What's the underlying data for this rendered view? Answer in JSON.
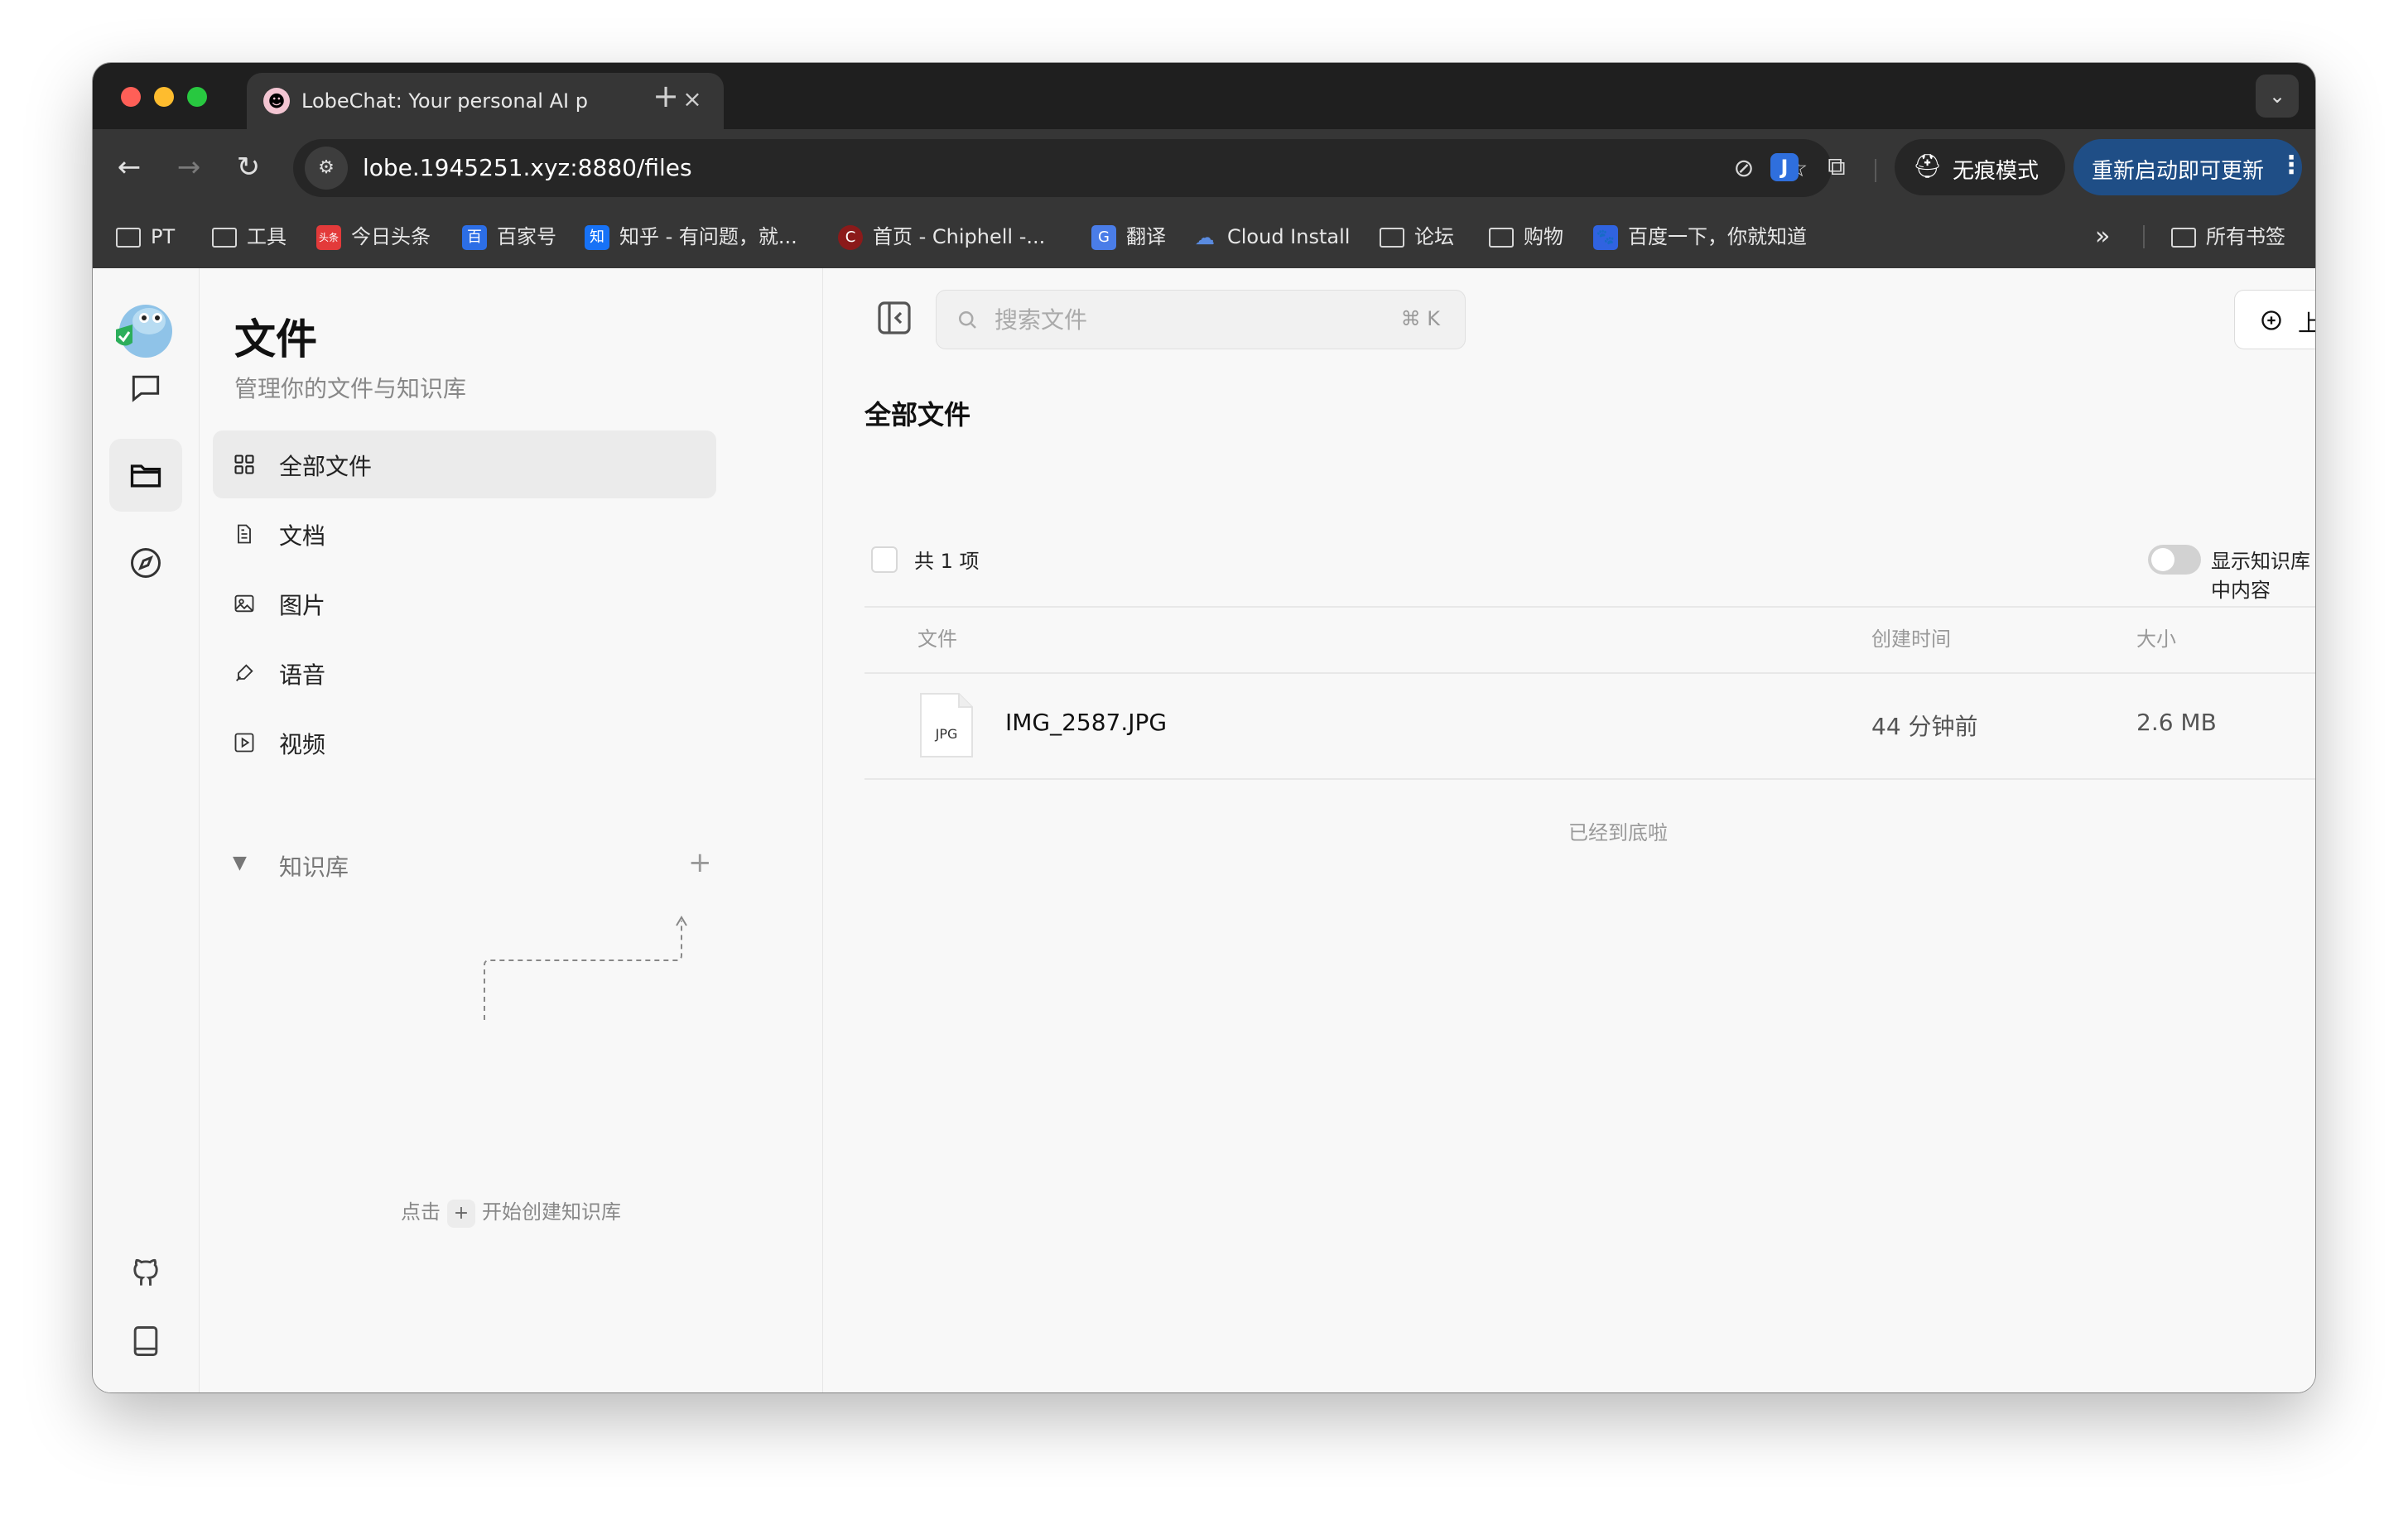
{
  "browser": {
    "tab_title": "LobeChat: Your personal AI p",
    "new_tab": "+",
    "close": "×",
    "url": "lobe.1945251.xyz:8880/files",
    "incognito_label": "无痕模式",
    "update_label": "重新启动即可更新",
    "bookmarks": [
      {
        "label": "PT",
        "icon": "folder-icon"
      },
      {
        "label": "工具",
        "icon": "folder-icon"
      },
      {
        "label": "今日头条",
        "icon": "toutiao-icon"
      },
      {
        "label": "百家号",
        "icon": "baijiahao-icon"
      },
      {
        "label": "知乎 - 有问题，就...",
        "icon": "zhihu-icon"
      },
      {
        "label": "首页 - Chiphell -...",
        "icon": "chiphell-icon"
      },
      {
        "label": "翻译",
        "icon": "translate-icon"
      },
      {
        "label": "Cloud Install",
        "icon": "cloud-icon"
      },
      {
        "label": "论坛",
        "icon": "folder-icon"
      },
      {
        "label": "购物",
        "icon": "folder-icon"
      },
      {
        "label": "百度一下，你就知道",
        "icon": "baidu-icon"
      }
    ],
    "all_bookmarks": "所有书签",
    "more_bookmarks": "»"
  },
  "panel": {
    "title": "文件",
    "subtitle": "管理你的文件与知识库",
    "nav": [
      {
        "label": "全部文件",
        "icon": "grid-icon",
        "active": true
      },
      {
        "label": "文档",
        "icon": "document-icon",
        "active": false
      },
      {
        "label": "图片",
        "icon": "image-icon",
        "active": false
      },
      {
        "label": "语音",
        "icon": "mic-icon",
        "active": false
      },
      {
        "label": "视频",
        "icon": "video-icon",
        "active": false
      }
    ],
    "kb_label": "知识库",
    "kb_hint_prefix": "点击",
    "kb_hint_plus": "+",
    "kb_hint_suffix": "开始创建知识库"
  },
  "main": {
    "search_placeholder": "搜索文件",
    "search_shortcut": "⌘ K",
    "upload_label": "上传",
    "section_title": "全部文件",
    "count_label": "共 1 项",
    "toggle_label": "显示知识库中内容",
    "toggle_on": false,
    "columns": {
      "file": "文件",
      "created": "创建时间",
      "size": "大小"
    },
    "files": [
      {
        "type": "JPG",
        "name": "IMG_2587.JPG",
        "created": "44 分钟前",
        "size": "2.6 MB"
      }
    ],
    "end_text": "已经到底啦"
  }
}
